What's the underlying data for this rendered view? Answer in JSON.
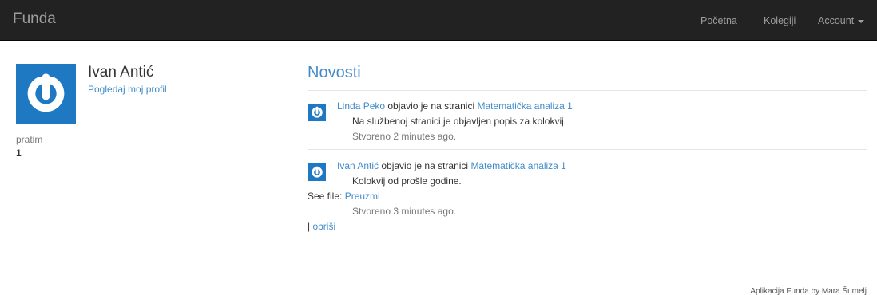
{
  "navbar": {
    "brand": "Funda",
    "links": {
      "home": "Početna",
      "courses": "Kolegiji",
      "account": "Account"
    }
  },
  "profile": {
    "name": "Ivan Antić",
    "profile_link": "Pogledaj moj profil",
    "stat_label": "pratim",
    "stat_value": "1"
  },
  "news": {
    "title": "Novosti",
    "items": [
      {
        "author": "Linda Peko",
        "action": " objavio je na stranici ",
        "page": "Matematička analiza 1",
        "body": "Na službenoj stranici je objavljen popis za kolokvij.",
        "time": "Stvoreno 2 minutes ago."
      },
      {
        "author": "Ivan Antić",
        "action": " objavio je na stranici ",
        "page": "Matematička analiza 1",
        "body": "Kolokvij od prošle godine.",
        "file_label": "See file: ",
        "file_link": "Preuzmi",
        "time": "Stvoreno 3 minutes ago.",
        "delete_sep": "| ",
        "delete_link": "obriši"
      }
    ]
  },
  "footer": {
    "text": "Aplikacija Funda by Mara Šumelj"
  },
  "icons": {
    "avatar": "power-icon"
  },
  "colors": {
    "navbar": "#222222",
    "link": "#428bca",
    "avatar_bg": "#1e78c2"
  }
}
